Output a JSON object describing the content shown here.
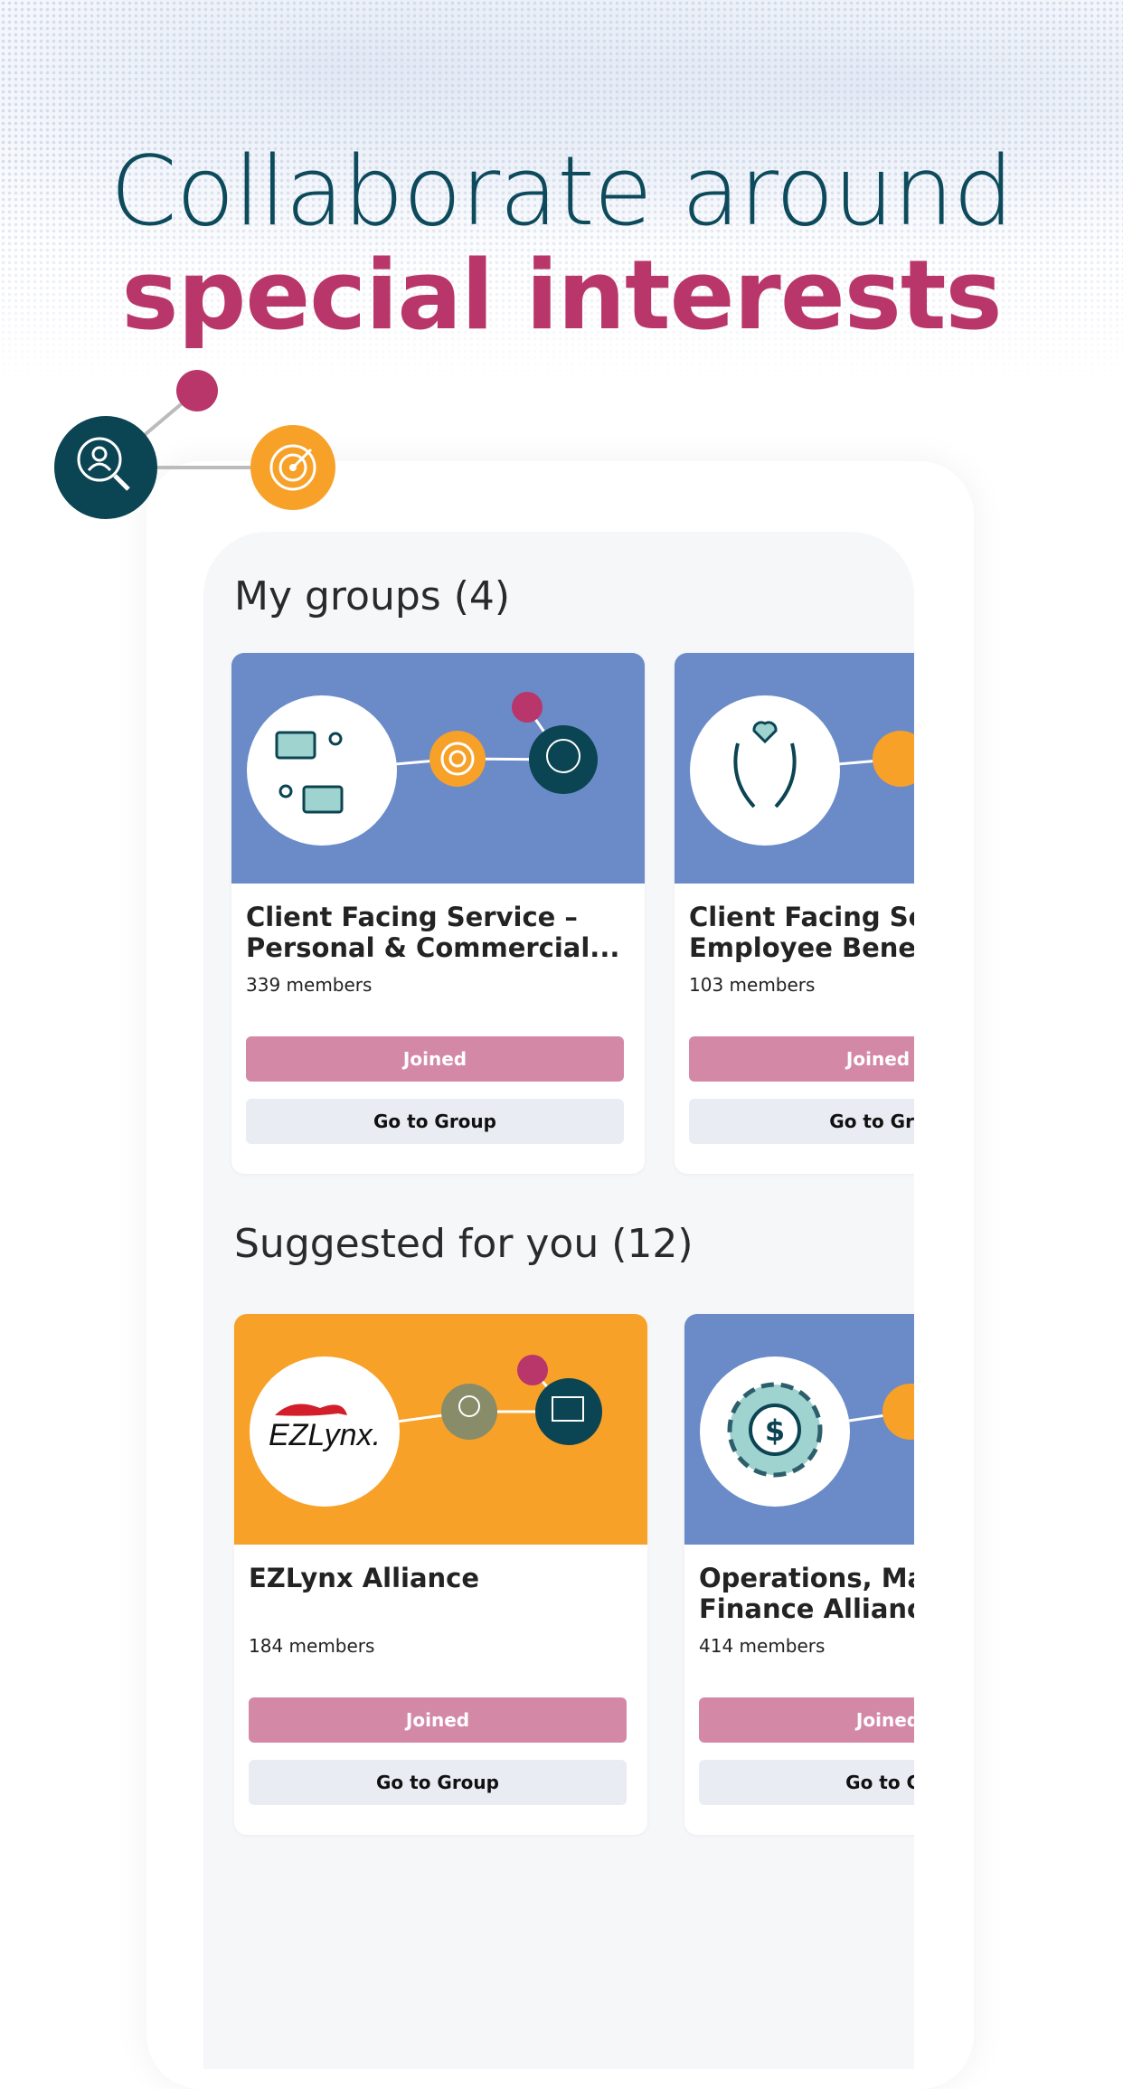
{
  "headline": {
    "line1": "Collaborate around",
    "line2": "special interests"
  },
  "colors": {
    "teal": "#0d4a5b",
    "pink": "#b9366a",
    "blue": "#6a8bc8",
    "orange": "#f7a128",
    "joined": "#d389a6",
    "go": "#e9ecf3"
  },
  "my_groups": {
    "title": "My groups (4)",
    "cards": [
      {
        "title1": "Client Facing Service –",
        "title2": "Personal & Commercial...",
        "members": "339 members",
        "joined": "Joined",
        "go": "Go to Group",
        "icon": "chat-people-icon"
      },
      {
        "title1": "Client Facing Ser",
        "title2": "Employee Benefi",
        "members": "103 members",
        "joined": "Joined",
        "go": "Go to Gro",
        "icon": "hands-heart-icon"
      }
    ]
  },
  "suggested": {
    "title": "Suggested for you (12)",
    "cards": [
      {
        "title1": "EZLynx Alliance",
        "title2": "",
        "members": "184 members",
        "joined": "Joined",
        "go": "Go to Group",
        "logo": "EZLynx."
      },
      {
        "title1": "Operations, Man",
        "title2": "Finance Alliance",
        "members": "414 members",
        "joined": "Joined",
        "go": "Go to Gr",
        "icon": "gear-dollar-icon"
      }
    ]
  }
}
